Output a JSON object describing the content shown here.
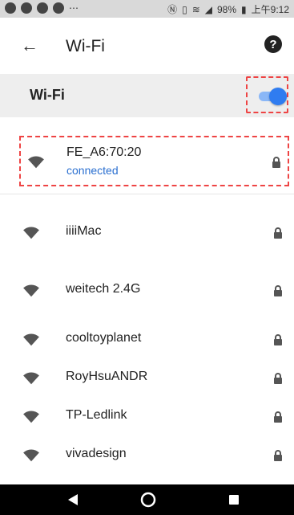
{
  "statusbar": {
    "battery": "98%",
    "time": "上午9:12"
  },
  "header": {
    "title": "Wi-Fi"
  },
  "wifi_toggle": {
    "label": "Wi-Fi",
    "enabled": true
  },
  "connected_network": {
    "ssid": "FE_A6:70:20",
    "status": "connected"
  },
  "networks": [
    {
      "ssid": "iiiiMac"
    },
    {
      "ssid": "weitech 2.4G"
    },
    {
      "ssid": "cooltoyplanet"
    },
    {
      "ssid": "RoyHsuANDR"
    },
    {
      "ssid": "TP-Ledlink"
    },
    {
      "ssid": "vivadesign"
    }
  ],
  "colors": {
    "accent": "#2f7cf0",
    "highlight": "#e44444"
  }
}
